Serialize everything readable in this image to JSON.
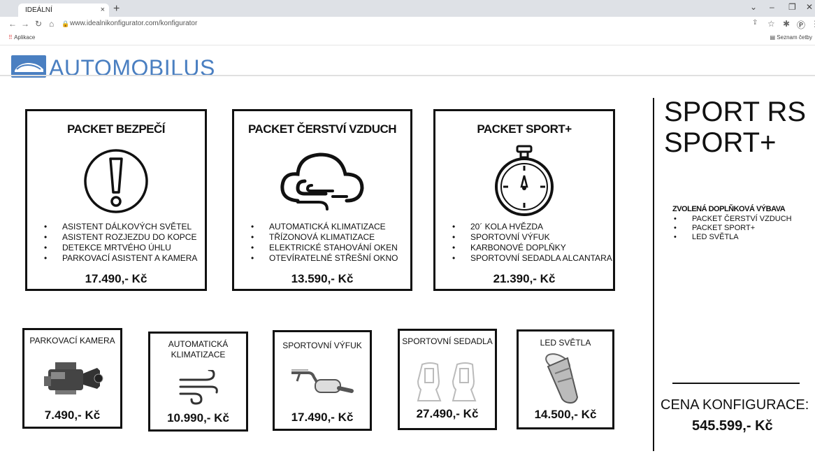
{
  "browser": {
    "tab_title": "IDEÁLNÍ KONFIGURÁTOR",
    "tab_close": "×",
    "new_tab": "+",
    "url": "www.idealnikonfigurator.com/konfigurator",
    "apps_label": "Aplikace",
    "reading_list_label": "Seznam četby",
    "window_controls": [
      "⌄",
      "–",
      "❐",
      "✕"
    ]
  },
  "header": {
    "brand": "AUTOMOBILUS",
    "brand_color": "#4a7fc1"
  },
  "packets": [
    {
      "title": "PACKET BEZPEČÍ",
      "icon": "warning-icon",
      "items": [
        "ASISTENT DÁLKOVÝCH SVĚTEL",
        "ASISTENT ROZJEZDU DO KOPCE",
        "DETEKCE MRTVÉHO ÚHLU",
        "PARKOVACÍ ASISTENT A KAMERA"
      ],
      "price": "17.490,- Kč"
    },
    {
      "title": "PACKET ČERSTVÍ VZDUCH",
      "icon": "cloud-wind-icon",
      "items": [
        "AUTOMATICKÁ KLIMATIZACE",
        "TŘÍZONOVÁ KLIMATIZACE",
        "ELEKTRICKÉ STAHOVÁNÍ OKEN",
        "OTEVÍRATELNÉ STŘEŠNÍ OKNO"
      ],
      "price": "13.590,- Kč"
    },
    {
      "title": "PACKET SPORT+",
      "icon": "stopwatch-icon",
      "items": [
        "20´ KOLA HVĚZDA",
        "SPORTOVNÍ VÝFUK",
        "KARBONOVÉ DOPLŇKY",
        "SPORTOVNÍ SEDADLA ALCANTARA"
      ],
      "price": "21.390,- Kč"
    }
  ],
  "options": [
    {
      "title": "PARKOVACÍ KAMERA",
      "icon": "camera-icon",
      "price": "7.490,- Kč"
    },
    {
      "title": "AUTOMATICKÁ KLIMATIZACE",
      "icon": "wind-icon",
      "price": "10.990,- Kč"
    },
    {
      "title": "SPORTOVNÍ VÝFUK",
      "icon": "exhaust-icon",
      "price": "17.490,- Kč"
    },
    {
      "title": "SPORTOVNÍ SEDADLA",
      "icon": "seat-icon",
      "price": "27.490,- Kč"
    },
    {
      "title": "LED SVĚTLA",
      "icon": "flashlight-icon",
      "price": "14.500,- Kč"
    }
  ],
  "summary": {
    "model_line1": "SPORT RS",
    "model_line2": "SPORT+",
    "selected_title": "ZVOLENÁ DOPLŇKOVÁ VÝBAVA",
    "selected_items": [
      "PACKET ČERSTVÍ VZDUCH",
      "PACKET SPORT+",
      "LED SVĚTLA"
    ],
    "total_label": "CENA KONFIGURACE:",
    "total_value": "545.599,- Kč"
  }
}
